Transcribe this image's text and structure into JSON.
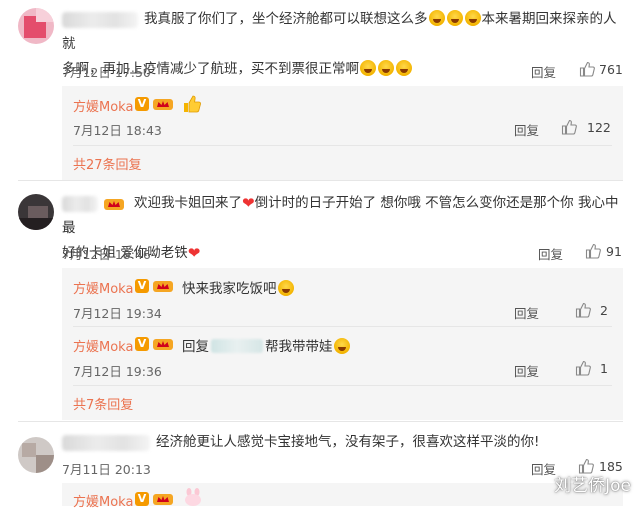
{
  "comments": [
    {
      "text_a": "我真服了你们了，坐个经济舱都可以联想这么多",
      "text_b": "本来暑期回来探亲的人就",
      "text_c": "多啊，再加上疫情减少了航班，买不到票很正常啊",
      "time": "7月12日 17:50",
      "reply_label": "回复",
      "likes": "761",
      "replies": [
        {
          "name": "方媛Moka",
          "time": "7月12日 18:43",
          "reply_label": "回复",
          "likes": "122"
        }
      ],
      "more": "共27条回复"
    },
    {
      "text_a": "欢迎我卡姐回来了",
      "text_b": "倒计时的日子开始了 想你哦 不管怎么变你还是那个你 我心中最",
      "text_c": "好的卡姐 爱你呦老铁",
      "time": "7月12日 18:46",
      "reply_label": "回复",
      "likes": "91",
      "replies": [
        {
          "name": "方媛Moka",
          "text": "快来我家吃饭吧",
          "time": "7月12日 19:34",
          "reply_label": "回复",
          "likes": "2"
        },
        {
          "name": "方媛Moka",
          "text_a": "回复",
          "text_b": "帮我带带娃",
          "time": "7月12日 19:36",
          "reply_label": "回复",
          "likes": "1"
        }
      ],
      "more": "共7条回复"
    },
    {
      "text_a": "经济舱更让人感觉卡宝接地气，没有架子，很喜欢这样平淡的你!",
      "time": "7月11日 20:13",
      "reply_label": "回复",
      "likes": "185",
      "replies": [
        {
          "name": "方媛Moka"
        }
      ]
    }
  ],
  "vip_badge": "V",
  "watermark": "刘艺侨Joe",
  "colors": {
    "accent": "#eb7350",
    "vip": "#f59a00",
    "heart": "#e33333"
  }
}
